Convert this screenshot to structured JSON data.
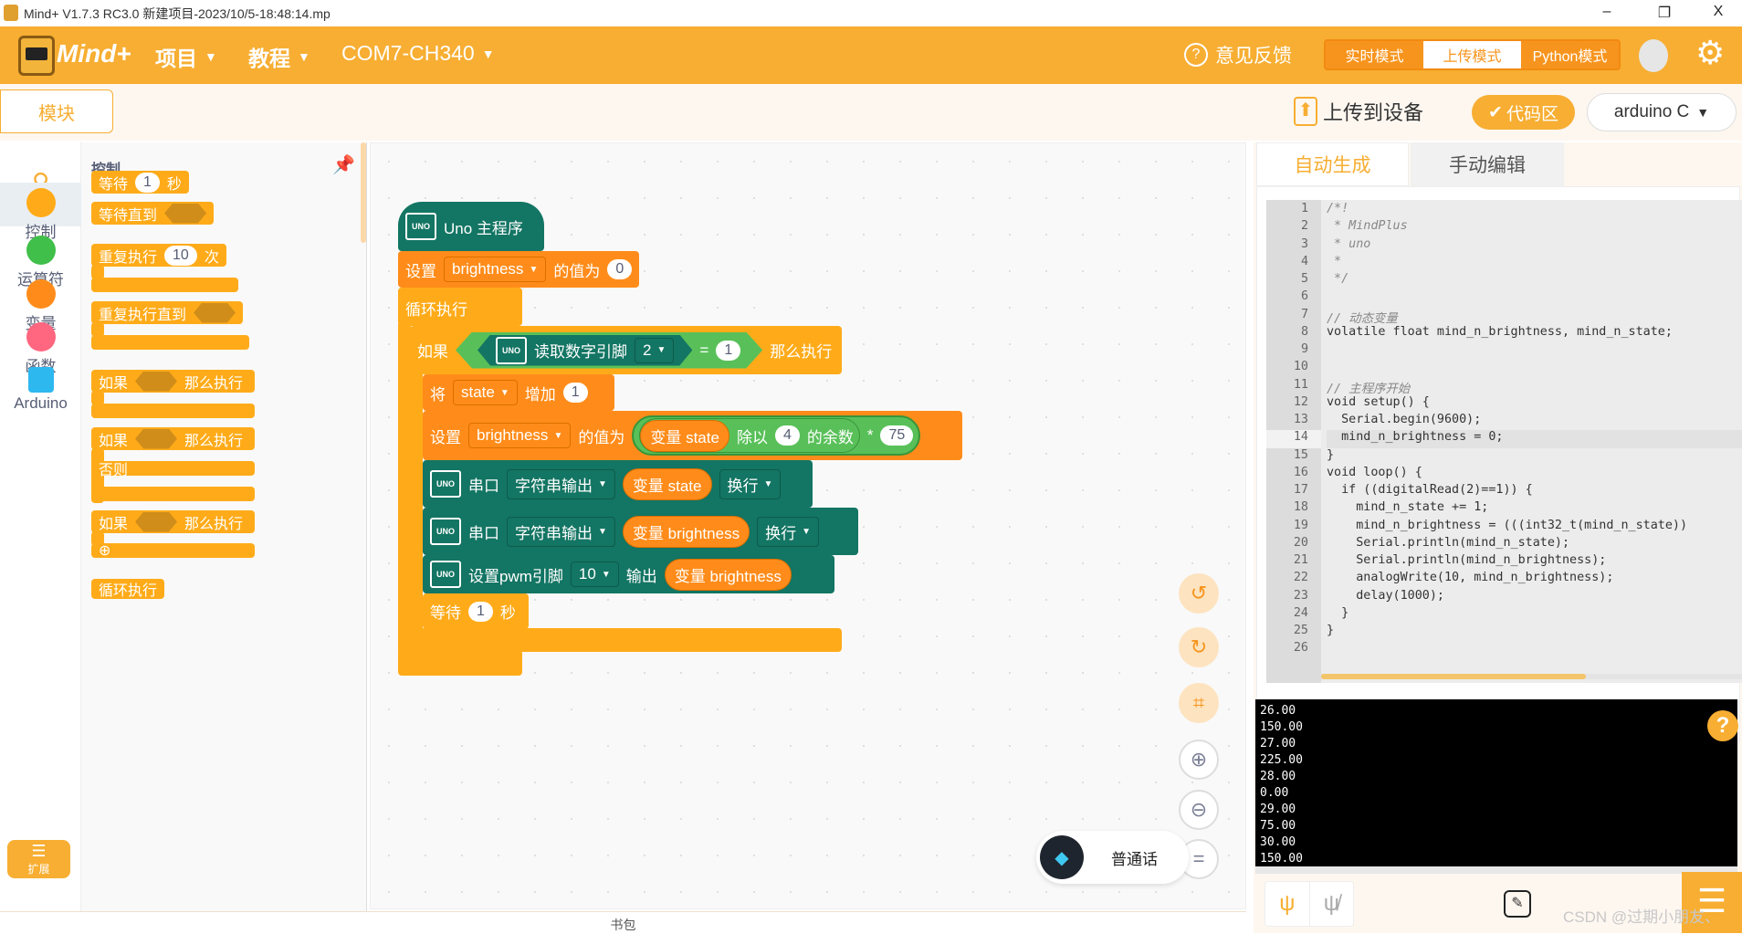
{
  "window": {
    "title": "Mind+ V1.7.3 RC3.0   新建项目-2023/10/5-18:48:14.mp",
    "minimize": "–",
    "maximize": "❐",
    "close": "X"
  },
  "header": {
    "logo": "Mind+",
    "menu_project": "项目",
    "menu_tutorial": "教程",
    "port": "COM7-CH340",
    "feedback": "意见反馈",
    "modes": [
      "实时模式",
      "上传模式",
      "Python模式"
    ],
    "active_mode": "上传模式",
    "accent": "#f7ae32"
  },
  "subbar": {
    "blocks_tab": "模块",
    "upload": "上传到设备",
    "code_area": "代码区",
    "language": "arduino C"
  },
  "categories": [
    {
      "label": "控制",
      "color": "#ffab19"
    },
    {
      "label": "运算符",
      "color": "#40bf4a"
    },
    {
      "label": "变量",
      "color": "#ff8c1a"
    },
    {
      "label": "函数",
      "color": "#ff6680"
    },
    {
      "label": "Arduino",
      "color": "#2eb8f0"
    }
  ],
  "extension": "扩展",
  "palette": {
    "title": "控制",
    "wait": "等待",
    "wait_val": "1",
    "sec": "秒",
    "wait_until": "等待直到",
    "repeat": "重复执行",
    "repeat_val": "10",
    "times": "次",
    "repeat_until": "重复执行直到",
    "if": "如果",
    "then": "那么执行",
    "else": "否则",
    "forever": "循环执行"
  },
  "workspace": {
    "hat": "Uno 主程序",
    "set": "设置",
    "var_brightness": "brightness",
    "value_is": "的值为",
    "init_val": "0",
    "forever": "循环执行",
    "if": "如果",
    "read_pin": "读取数字引脚",
    "pin": "2",
    "eq": "=",
    "eq_val": "1",
    "then": "那么执行",
    "change": "将",
    "var_state": "state",
    "increase": "增加",
    "inc_val": "1",
    "var_label_state": "变量 state",
    "mod": "除以",
    "mod_val": "4",
    "remainder": "的余数",
    "mul": "*",
    "mul_val": "75",
    "serial": "串口",
    "string_out": "字符串输出",
    "newline": "换行",
    "var_label_brightness": "变量 brightness",
    "pwm": "设置pwm引脚",
    "pwm_pin": "10",
    "output": "输出",
    "wait": "等待",
    "wait_val": "1",
    "sec": "秒",
    "voice": "普通话",
    "uno": "UNO"
  },
  "backpack": "书包",
  "code": {
    "tabs": [
      "自动生成",
      "手动编辑"
    ],
    "active_tab": "自动生成",
    "highlight_line": 14,
    "lines": [
      "/*!",
      " * MindPlus",
      " * uno",
      " *",
      " */",
      "",
      "// 动态变量",
      "volatile float mind_n_brightness, mind_n_state;",
      "",
      "",
      "// 主程序开始",
      "void setup() {",
      "  Serial.begin(9600);",
      "  mind_n_brightness = 0;",
      "}",
      "void loop() {",
      "  if ((digitalRead(2)==1)) {",
      "    mind_n_state += 1;",
      "    mind_n_brightness = (((int32_t(mind_n_state))",
      "    Serial.println(mind_n_state);",
      "    Serial.println(mind_n_brightness);",
      "    analogWrite(10, mind_n_brightness);",
      "    delay(1000);",
      "  }",
      "}",
      ""
    ]
  },
  "serial": {
    "lines": [
      "26.00",
      "150.00",
      "27.00",
      "225.00",
      "28.00",
      "0.00",
      "29.00",
      "75.00",
      "30.00",
      "150.00"
    ]
  },
  "watermark": "CSDN @过期小朋友、"
}
